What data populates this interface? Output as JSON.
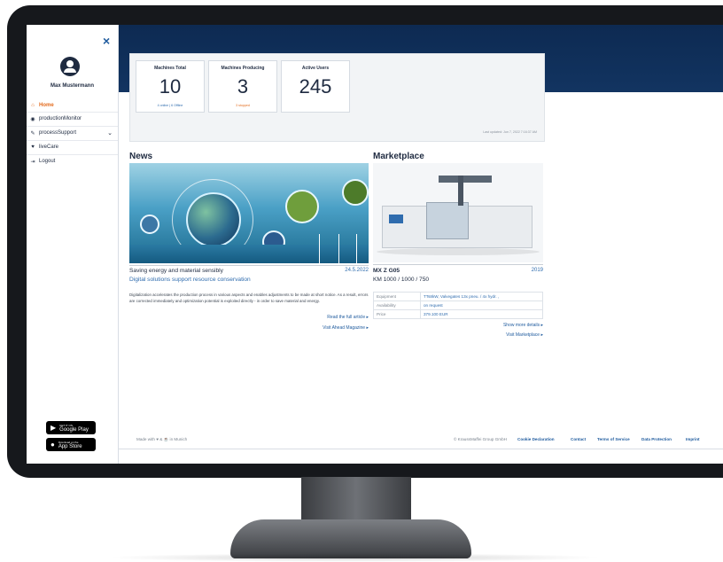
{
  "sidebar": {
    "user_name": "Max Mustermann",
    "close_icon": "×",
    "items": [
      {
        "label": "Home",
        "icon": "home-icon",
        "glyph": "⌂"
      },
      {
        "label": "productionMonitor",
        "icon": "monitor-icon",
        "glyph": "◉"
      },
      {
        "label": "processSupport",
        "icon": "wrench-icon",
        "glyph": "✎",
        "chevron": "⌄"
      },
      {
        "label": "liveCare",
        "icon": "heart-icon",
        "glyph": "♥"
      },
      {
        "label": "Logout",
        "icon": "logout-icon",
        "glyph": "⇥"
      }
    ],
    "store_badges": {
      "google_small": "GET IT ON",
      "google": "Google Play",
      "apple_small": "Download on the",
      "apple": "App Store"
    }
  },
  "header": {
    "accent_color": "#0d2a52",
    "flag_icon": "●",
    "fullscreen_icon": "⛶"
  },
  "kpis": {
    "machines_total": {
      "title": "Machines Total",
      "value": "10",
      "sub": "4 online | 6 Offline"
    },
    "machines_producing": {
      "title": "Machines Producing",
      "value": "3",
      "sub": "3 stopped"
    },
    "active_users": {
      "title": "Active Users",
      "value": "245",
      "sub": ""
    },
    "last_updated": "Last updated: Jun 7, 2022 7:16:37 AM"
  },
  "news": {
    "section_title": "News",
    "headline": "Saving energy and material sensibly",
    "date": "24.5.2022",
    "subheadline": "Digital solutions support resource conservation",
    "body": "Digitalization accelerates the production process in various aspects and enables adjustments to be made at short notice. As a result, errors are corrected immediately and optimization potential is exploited directly - in order to save material and energy.",
    "read_more": "Read the full article ▸",
    "visit_magazine": "Visit Ahead Magazine ▸"
  },
  "marketplace": {
    "section_title": "Marketplace",
    "product_name": "MX Z G05",
    "year": "2019",
    "model": "KM 1000 / 1000 / 750",
    "specs": [
      {
        "key": "Equipment",
        "value": "TTs8kW, Valvegates 13x pneu. / 4x hydr. ,"
      },
      {
        "key": "Availability",
        "value": "on request"
      },
      {
        "key": "Price",
        "value": "379.100 EUR"
      }
    ],
    "show_more": "Show more details ▸",
    "visit_marketplace": "Visit Marketplace ▸"
  },
  "footer": {
    "made_with": "Made with ♥ & ☕ in Munich",
    "copyright": "© KraussMaffei Group GmbH",
    "links": [
      "Cookie Declaration",
      "Contact",
      "Terms of Service",
      "Data Protection",
      "Imprint"
    ]
  }
}
